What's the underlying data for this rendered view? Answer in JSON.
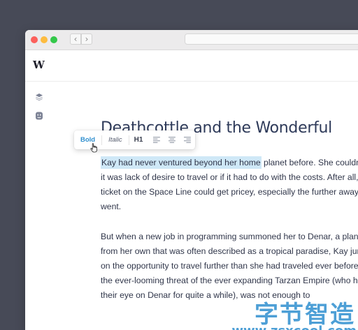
{
  "app": {
    "logo_letter": "W"
  },
  "window": {
    "traffic_colors": [
      "#fc605c",
      "#fdbc40",
      "#34c84a"
    ],
    "back_glyph": "‹",
    "forward_glyph": "›"
  },
  "sidebar": {
    "icons": [
      "layers-icon",
      "face-icon"
    ]
  },
  "document": {
    "title": "Deathcottle and the Wonderful",
    "paragraph1": {
      "highlighted": "Kay had never ventured beyond her home",
      "line1_rest": " planet before. She couldn’t t",
      "lines": [
        "it was lack of desire to travel or if it had to do with the costs. After all, a",
        "ticket on the Space Line could get pricey, especially the further away o",
        "went."
      ]
    },
    "paragraph2": {
      "lines": [
        "But when a new job in programming summoned her to Denar, a planet f",
        "from her own that was often described as a tropical paradise, Kay jump",
        "on the opportunity to travel further than she had traveled ever before. E",
        "the ever-looming threat of the ever expanding Tarzan Empire (who had",
        "their eye on Denar for quite a while), was not enough to"
      ]
    }
  },
  "format_toolbar": {
    "bold_label": "Bold",
    "italic_label": "Italic",
    "heading_label": "H1",
    "align_icons": [
      "align-left-icon",
      "align-center-icon",
      "align-right-icon"
    ],
    "active": "bold",
    "accent_color": "#2f8fcf"
  },
  "watermark": {
    "chinese_text": "字节智造",
    "url": "www.zsxcool.com"
  }
}
